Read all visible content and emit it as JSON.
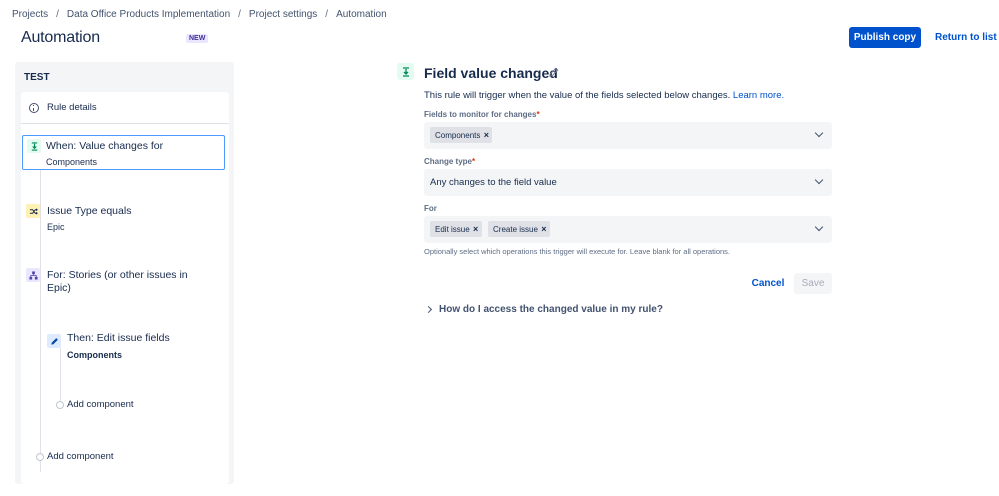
{
  "breadcrumb": {
    "items": [
      "Projects",
      "Data Office Products Implementation",
      "Project settings",
      "Automation"
    ],
    "separator": "/"
  },
  "header": {
    "title": "Automation",
    "badge": "NEW",
    "publish_label": "Publish copy",
    "return_label": "Return to list"
  },
  "rule": {
    "name": "TEST",
    "details_label": "Rule details",
    "trigger": {
      "title": "When: Value changes for",
      "subtitle": "Components",
      "icon": "field-changed-icon"
    },
    "condition": {
      "title": "Issue Type equals",
      "subtitle": "Epic",
      "icon": "shuffle-icon"
    },
    "branch": {
      "title_line1": "For: Stories (or other issues in",
      "title_line2": "Epic)",
      "icon": "hierarchy-icon"
    },
    "action": {
      "title": "Then: Edit issue fields",
      "subtitle": "Components",
      "icon": "pencil-icon"
    },
    "add_component_inner": "Add component",
    "add_component_outer": "Add component"
  },
  "form": {
    "title": "Field value changed",
    "description": "This rule will trigger when the value of the fields selected below changes.",
    "learn_more": "Learn more.",
    "fields_label": "Fields to monitor for changes",
    "fields_tags": [
      "Components"
    ],
    "change_type_label": "Change type",
    "change_type_value": "Any changes to the field value",
    "for_label": "For",
    "for_tags": [
      "Edit issue",
      "Create issue"
    ],
    "help_text": "Optionally select which operations this trigger will execute for. Leave blank for all operations.",
    "required_marker": "*",
    "cancel_label": "Cancel",
    "save_label": "Save",
    "expander_label": "How do I access the changed value in my rule?"
  },
  "colors": {
    "brand": "#0052cc",
    "selected_border": "#4c9aff",
    "trigger_icon_bg": "#e3fcef",
    "condition_icon_bg": "#fff0b3",
    "branch_icon_bg": "#eae6ff",
    "action_icon_bg": "#deebff"
  }
}
